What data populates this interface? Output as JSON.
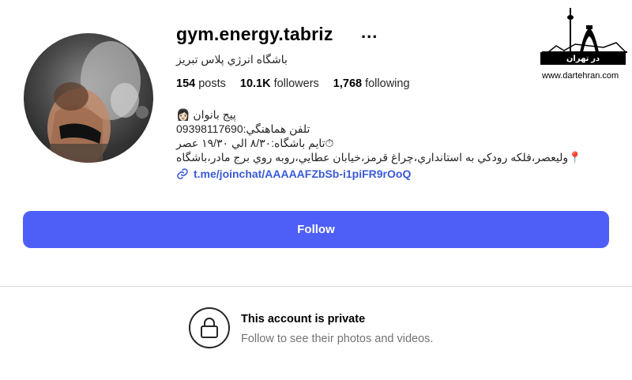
{
  "profile": {
    "username": "gym.energy.tabriz",
    "more_icon": "...",
    "full_name": "باشگاه انرژي پلاس تبريز",
    "stats": {
      "posts_count": "154",
      "posts_label": "posts",
      "followers_count": "10.1K",
      "followers_label": "followers",
      "following_count": "1,768",
      "following_label": "following"
    },
    "bio": {
      "line1": "پیج بانوان 👩🏻",
      "line2": "تلفن هماهنگي:09398117690",
      "line3": "⏱تايم باشگاه:۸/۳۰ الي ۱۹/۳۰ عصر",
      "line4": "📍وليعصر،فلكه رودكي به استانداري،چراغ قرمز،خيابان عطايي،روبه روي برج مادر،باشگاه",
      "link": "t.me/joinchat/AAAAAFZbSb-i1piFR9rOoQ"
    }
  },
  "actions": {
    "follow_label": "Follow"
  },
  "private_notice": {
    "title": "This account is private",
    "subtitle": "Follow to see their photos and videos."
  },
  "watermark": {
    "brand": "در تهران",
    "url": "www.dartehran.com"
  },
  "colors": {
    "accent": "#4d5ff7",
    "link": "#3a5ad6",
    "muted": "#737373",
    "divider": "#dbdbdb"
  }
}
